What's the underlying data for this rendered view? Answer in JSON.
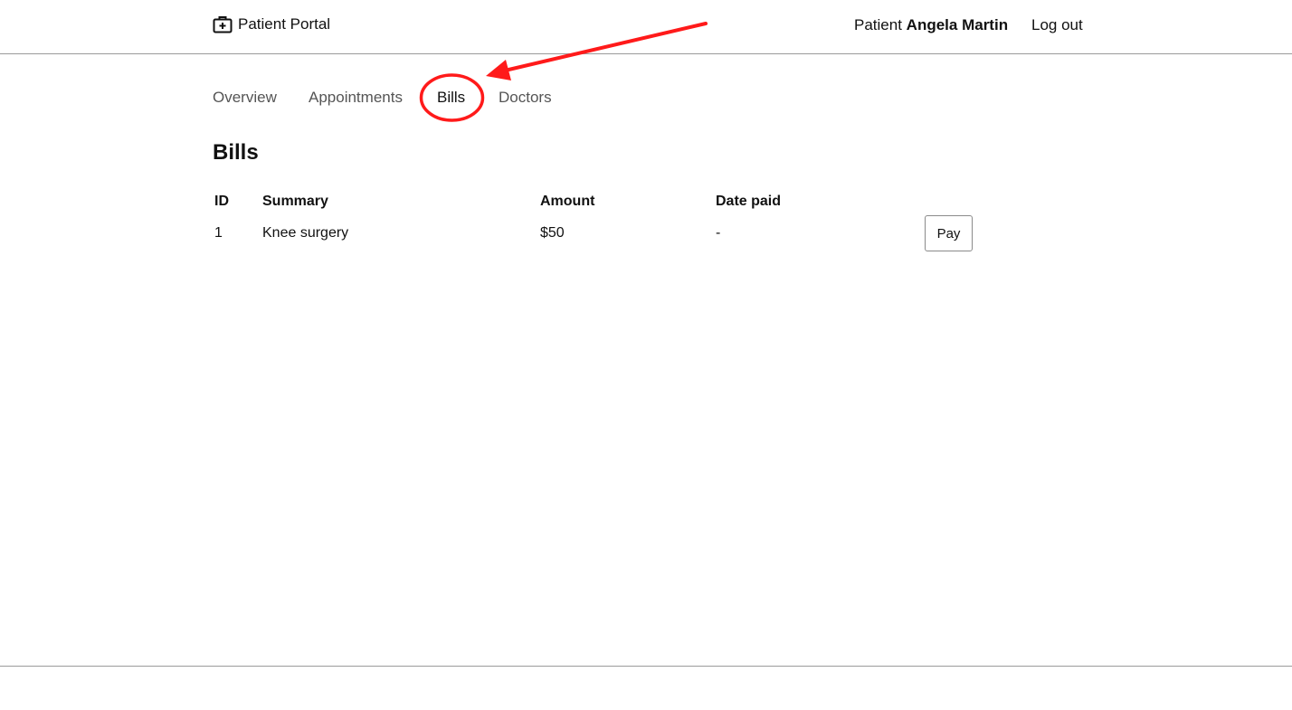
{
  "header": {
    "brand_label": "Patient Portal",
    "brand_icon": "medical-briefcase-icon",
    "user_prefix": "Patient",
    "user_name": "Angela Martin",
    "logout_label": "Log out"
  },
  "tabs": [
    {
      "label": "Overview",
      "active": false
    },
    {
      "label": "Appointments",
      "active": false
    },
    {
      "label": "Bills",
      "active": true
    },
    {
      "label": "Doctors",
      "active": false
    }
  ],
  "page": {
    "title": "Bills"
  },
  "bills_table": {
    "columns": [
      "ID",
      "Summary",
      "Amount",
      "Date paid"
    ],
    "rows": [
      {
        "id": "1",
        "summary": "Knee surgery",
        "amount": "$50",
        "date_paid": "-",
        "action_label": "Pay"
      }
    ]
  },
  "annotation": {
    "color": "#ff1a1a",
    "target": "Bills tab"
  }
}
